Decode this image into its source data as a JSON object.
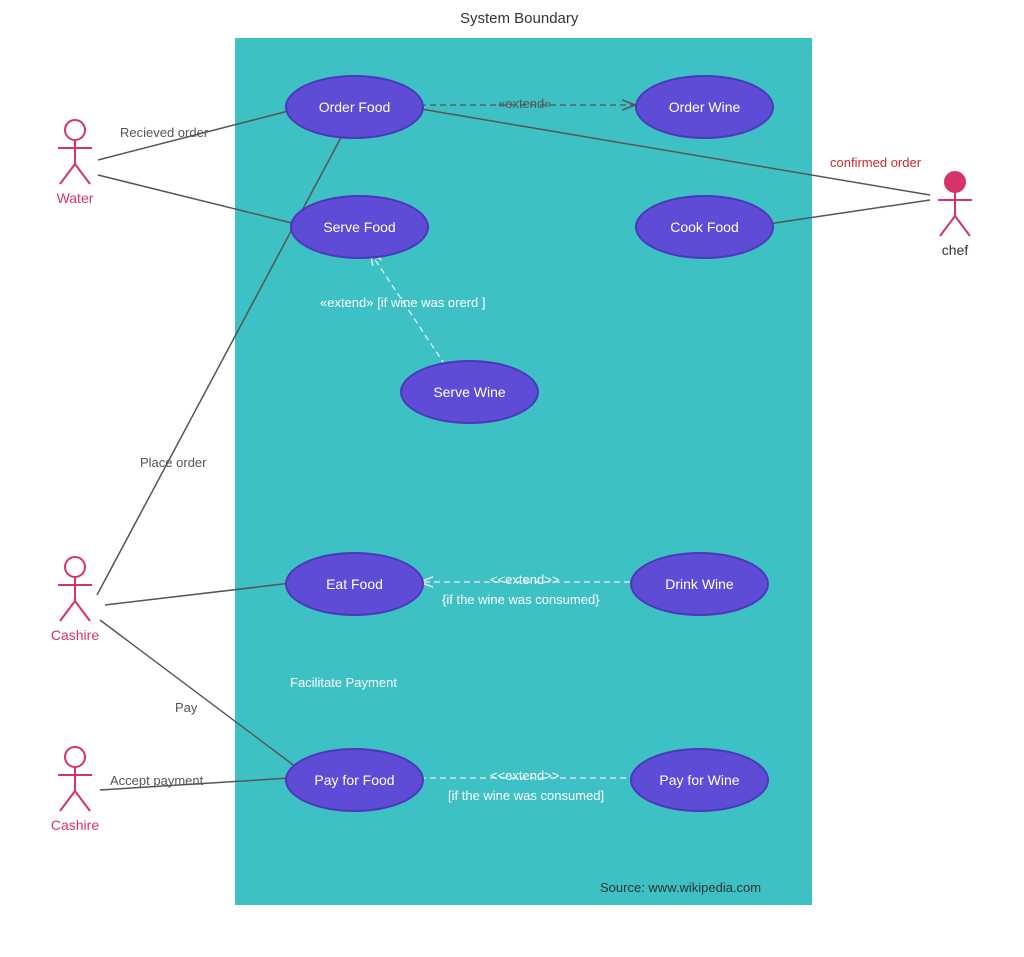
{
  "title": "System Boundary",
  "source": "Source: www.wikipedia.com",
  "actors": {
    "water": "Water",
    "cashire1": "Cashire",
    "cashire2": "Cashire",
    "chef": "chef"
  },
  "usecases": {
    "order_food": "Order Food",
    "order_wine": "Order Wine",
    "serve_food": "Serve Food",
    "cook_food": "Cook Food",
    "serve_wine": "Serve Wine",
    "eat_food": "Eat Food",
    "drink_wine": "Drink Wine",
    "pay_for_food": "Pay for Food",
    "pay_for_wine": "Pay for Wine"
  },
  "labels": {
    "recieved_order": "Recieved order",
    "confirmed_order": "confirmed order",
    "place_order": "Place order",
    "pay": "Pay",
    "accept_payment": "Accept payment",
    "facilitate_payment": "Facilitate Payment",
    "extend1": "«extend»",
    "extend_wine_orerd": "«extend» [if wine was orerd ]",
    "extend2": "<<extend>>",
    "cond_consumed1": "{if the wine was consumed}",
    "extend3": "<<extend>>",
    "cond_consumed2": "[if the wine was consumed]"
  }
}
